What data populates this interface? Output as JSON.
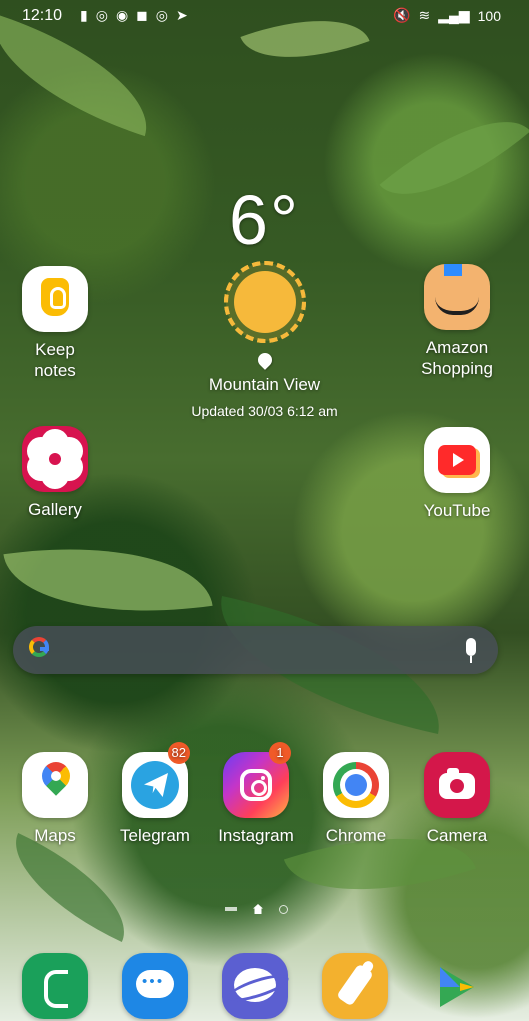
{
  "status_bar": {
    "time": "12:10",
    "left_icons": [
      "sim-icon",
      "instagram-icon",
      "account-icon",
      "meet-icon",
      "instagram-icon",
      "telegram-icon"
    ],
    "battery_text": "100"
  },
  "weather": {
    "temperature": "6°",
    "location": "Mountain View",
    "updated": "Updated 30/03 6:12 am"
  },
  "apps": {
    "keep_notes": {
      "label": "Keep\nnotes"
    },
    "amazon_shopping": {
      "label": "Amazon\nShopping"
    },
    "gallery": {
      "label": "Gallery"
    },
    "youtube": {
      "label": "YouTube"
    },
    "maps": {
      "label": "Maps"
    },
    "telegram": {
      "label": "Telegram",
      "badge": "82"
    },
    "instagram": {
      "label": "Instagram",
      "badge": "1"
    },
    "chrome": {
      "label": "Chrome"
    },
    "camera": {
      "label": "Camera"
    }
  },
  "search": {
    "brand_icon": "google-icon",
    "mic_icon": "microphone-icon"
  },
  "dock": {
    "items": [
      "phone-icon",
      "messages-icon",
      "internet-icon",
      "baby-bottle-icon",
      "play-store-icon"
    ]
  },
  "page_indicator": {
    "current": "home"
  },
  "colors": {
    "search_background": "#484e58",
    "badge": "#f05a28"
  }
}
